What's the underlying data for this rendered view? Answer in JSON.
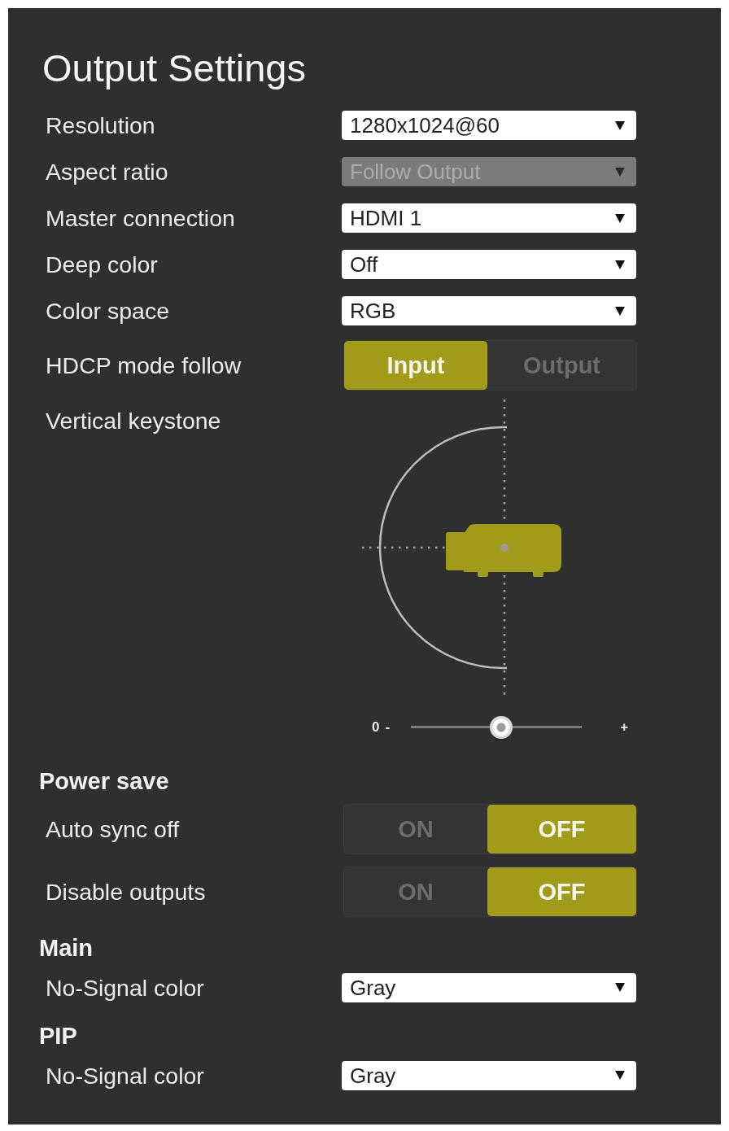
{
  "panel": {
    "title": "Output Settings"
  },
  "rows": [
    {
      "kind": "select",
      "label": "Resolution",
      "value": "1280x1024@60",
      "disabled": false
    },
    {
      "kind": "select",
      "label": "Aspect ratio",
      "value": "Follow Output",
      "disabled": true
    },
    {
      "kind": "select",
      "label": "Master connection",
      "value": "HDMI 1",
      "disabled": false
    },
    {
      "kind": "select",
      "label": "Deep color",
      "value": "Off",
      "disabled": false
    },
    {
      "kind": "select",
      "label": "Color space",
      "value": "RGB",
      "disabled": false
    },
    {
      "kind": "segmented",
      "label": "HDCP mode follow",
      "options": [
        {
          "label": "Input",
          "selected": true
        },
        {
          "label": "Output",
          "selected": false
        }
      ]
    },
    {
      "kind": "keystone",
      "label": "Vertical keystone",
      "value": "0",
      "minus": "-",
      "plus": "+",
      "level": 0.53
    },
    {
      "kind": "heading",
      "label": "Power save"
    },
    {
      "kind": "segmented",
      "label": "Auto sync off",
      "options": [
        {
          "label": "ON",
          "selected": false
        },
        {
          "label": "OFF",
          "selected": true
        }
      ]
    },
    {
      "kind": "segmented",
      "label": "Disable outputs",
      "options": [
        {
          "label": "ON",
          "selected": false
        },
        {
          "label": "OFF",
          "selected": true
        }
      ]
    },
    {
      "kind": "heading",
      "label": "Main"
    },
    {
      "kind": "select",
      "label": "No-Signal color",
      "value": "Gray",
      "disabled": false
    },
    {
      "kind": "heading",
      "label": "PIP"
    },
    {
      "kind": "select",
      "label": "No-Signal color",
      "value": "Gray",
      "disabled": false
    }
  ]
}
